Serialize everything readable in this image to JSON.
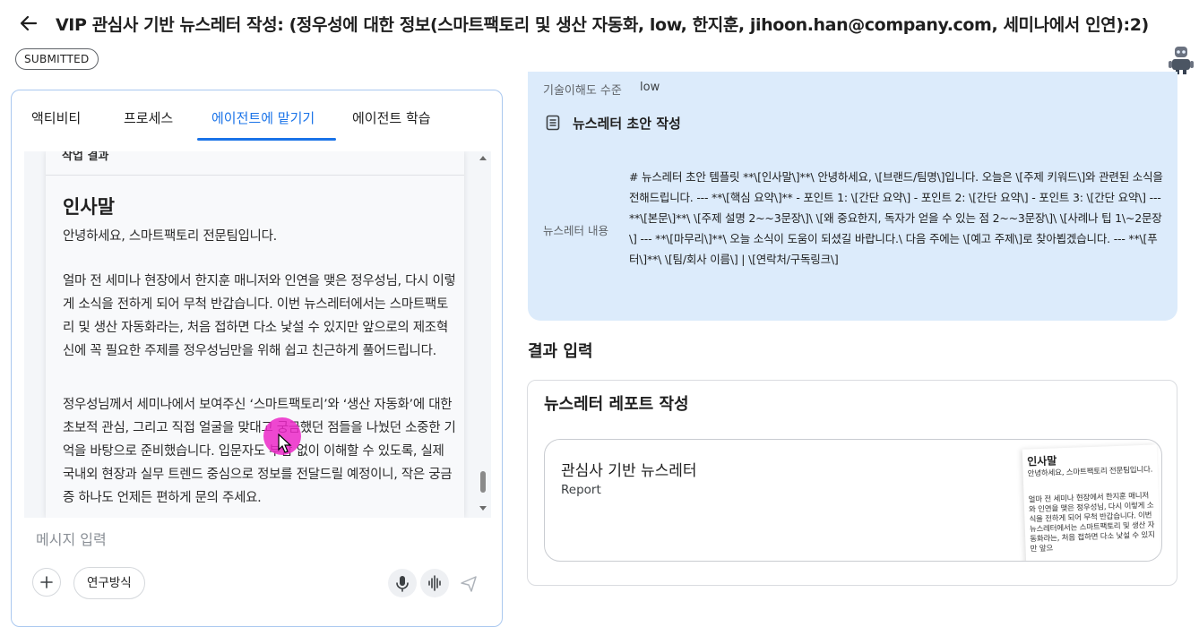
{
  "header": {
    "title": "VIP 관심사 기반 뉴스레터 작성: (정우성에 대한 정보(스마트팩토리 및 생산 자동화, low, 한지훈, jihoon.han@company.com, 세미나에서 인연):2)",
    "status": "SUBMITTED"
  },
  "left": {
    "tabs": [
      {
        "label": "액티비티"
      },
      {
        "label": "프로세스"
      },
      {
        "label": "에이전트에 맡기기"
      },
      {
        "label": "에이전트 학습"
      }
    ],
    "active_tab": "에이전트에 맡기기",
    "doc": {
      "cut_heading": "작업 결과",
      "heading": "인사말",
      "paragraphs": [
        "안녕하세요, 스마트팩토리 전문팀입니다.",
        "얼마 전 세미나 현장에서 한지훈 매니저와 인연을 맺은 정우성님, 다시 이렇게 소식을 전하게 되어 무척 반갑습니다. 이번 뉴스레터에서는 스마트팩토리 및 생산 자동화라는, 처음 접하면 다소 낯설 수 있지만 앞으로의 제조혁신에 꼭 필요한 주제를 정우성님만을 위해 쉽고 친근하게 풀어드립니다.",
        "정우성님께서 세미나에서 보여주신 ‘스마트팩토리’와 ‘생산 자동화’에 대한 초보적 관심, 그리고 직접 얼굴을 맞대고 궁금했던 점들을 나눴던 소중한 기억을 바탕으로 준비했습니다. 입문자도 부담 없이 이해할 수 있도록, 실제 국내외 현장과 실무 트렌드 중심으로 정보를 전달드릴 예정이니, 작은 궁금증 하나도 언제든 편하게 문의 주세요."
      ]
    },
    "composer": {
      "placeholder": "메시지 입력",
      "method_chip": "연구방식"
    }
  },
  "right": {
    "skill_label": "기술이해도 수준",
    "skill_value": "low",
    "draft_title": "뉴스레터 초안 작성",
    "content_label": "뉴스레터 내용",
    "content_text": "# 뉴스레터 초안 템플릿 **\\[인사말\\]**\\ 안녕하세요, \\[브랜드/팀명\\]입니다. 오늘은 \\[주제 키워드\\]와 관련된 소식을 전해드립니다. --- **\\[핵심 요약\\]** - 포인트 1: \\[간단 요약\\] - 포인트 2: \\[간단 요약\\] - 포인트 3: \\[간단 요약\\] --- **\\[본문\\]**\\ \\[주제 설명 2~~3문장\\]\\ \\[왜 중요한지, 독자가 얻을 수 있는 점 2~~3문장\\]\\ \\[사례나 팁 1\\~2문장\\] --- **\\[마무리\\]**\\ 오늘 소식이 도움이 되셨길 바랍니다.\\ 다음 주에는 \\[예고 주제\\]로 찾아뵙겠습니다. --- **\\[푸터\\]**\\ \\[팀/회사 이름\\] | \\[연락처/구독링크\\]",
    "result_heading": "결과 입력",
    "report_heading": "뉴스레터 레포트 작성",
    "report_chip": {
      "title": "관심사 기반 뉴스레터",
      "subtitle": "Report",
      "thumb_heading": "인사말",
      "thumb_line1": "안녕하세요, 스마트팩토리 전문팀입니다.",
      "thumb_line2": "얼마 전 세미나 현장에서 한지훈 매니저와 인연을 맺은 정우성님, 다시 이렇게 소식을 전하게 되어 무척 반갑습니다. 이번 뉴스레터에서는 스마트팩토리 및 생산 자동화라는, 처음 접하면 다소 낯설 수 있지만 앞으"
    }
  }
}
